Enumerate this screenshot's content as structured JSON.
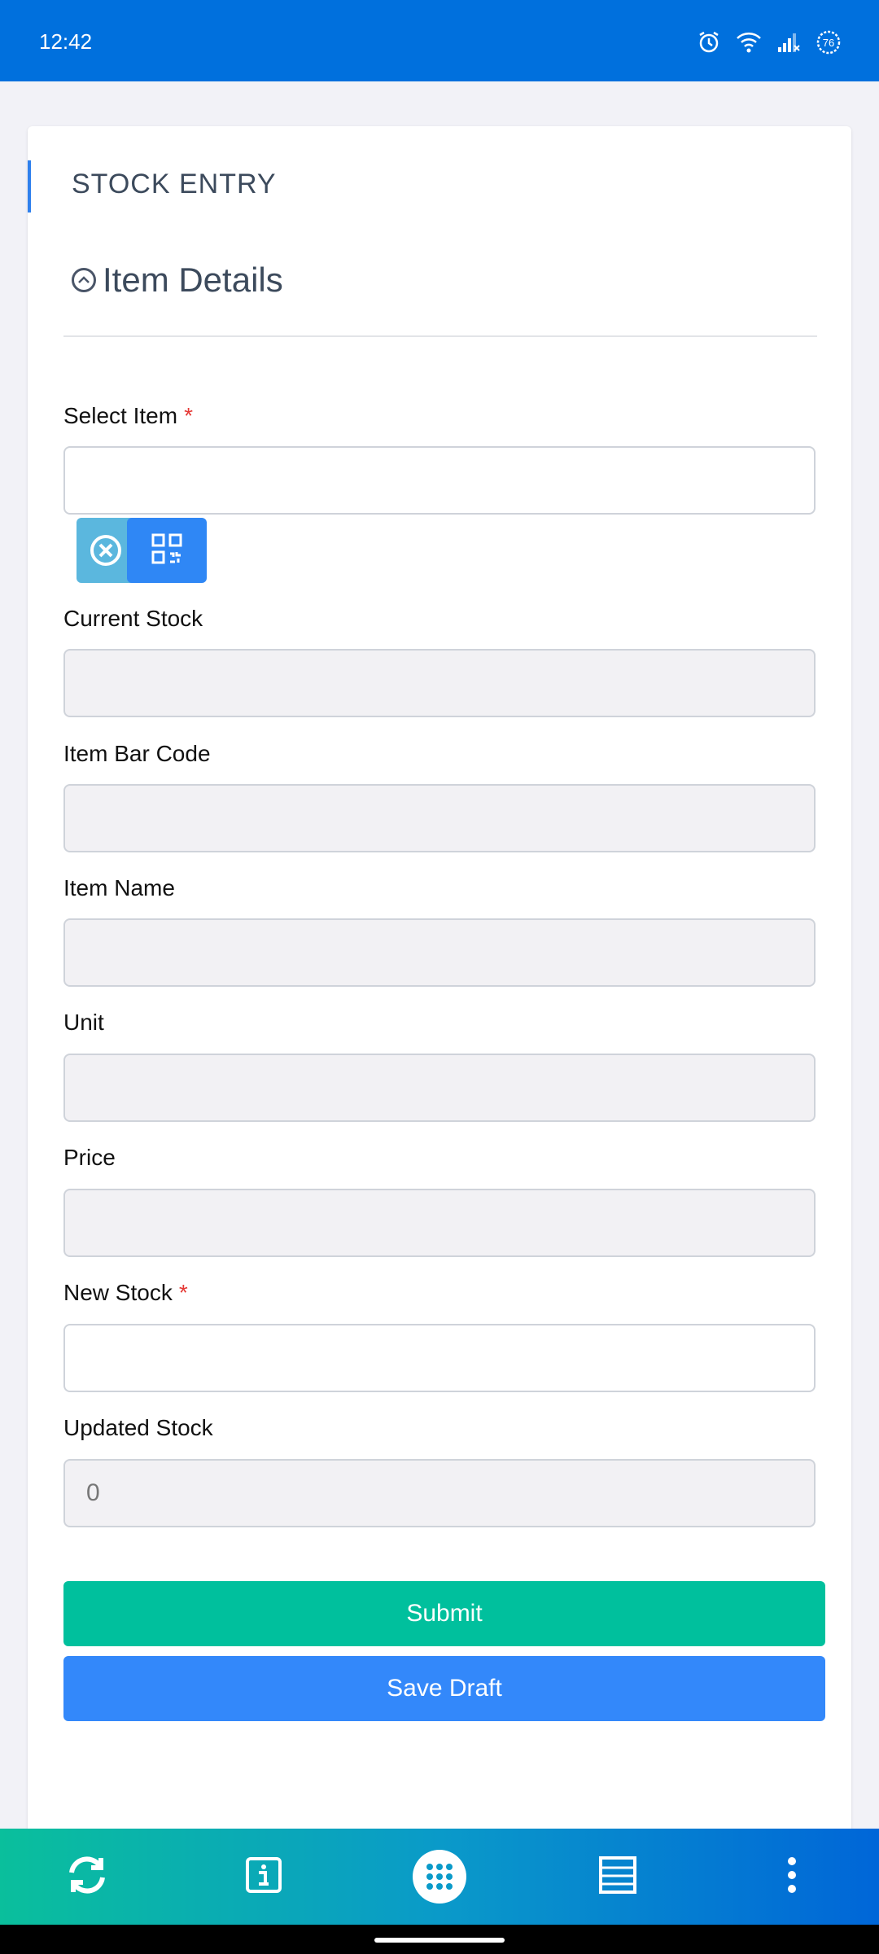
{
  "status_bar": {
    "time": "12:42",
    "battery_level": "76",
    "icons": [
      "alarm-icon",
      "wifi-icon",
      "signal-icon",
      "battery-icon"
    ]
  },
  "page": {
    "title": "STOCK ENTRY",
    "section_title": "Item Details"
  },
  "form": {
    "select_item": {
      "label": "Select Item",
      "required_mark": "*",
      "value": ""
    },
    "current_stock": {
      "label": "Current Stock",
      "value": ""
    },
    "item_bar_code": {
      "label": "Item Bar Code",
      "value": ""
    },
    "item_name": {
      "label": "Item Name",
      "value": ""
    },
    "unit": {
      "label": "Unit",
      "value": ""
    },
    "price": {
      "label": "Price",
      "value": ""
    },
    "new_stock": {
      "label": "New Stock",
      "required_mark": "*",
      "value": ""
    },
    "updated_stock": {
      "label": "Updated Stock",
      "value": "0"
    }
  },
  "actions": {
    "submit_label": "Submit",
    "save_draft_label": "Save Draft"
  },
  "colors": {
    "status_bar": "#0070dd",
    "submit": "#00c09d",
    "save_draft": "#3388fa",
    "clear_button": "#5bb7de",
    "scan_button": "#2f87f5",
    "accent": "#2f80ed"
  },
  "bottom_nav": {
    "items": [
      "sync-icon",
      "info-icon",
      "apps-grid-icon",
      "list-icon",
      "more-vertical-icon"
    ]
  }
}
